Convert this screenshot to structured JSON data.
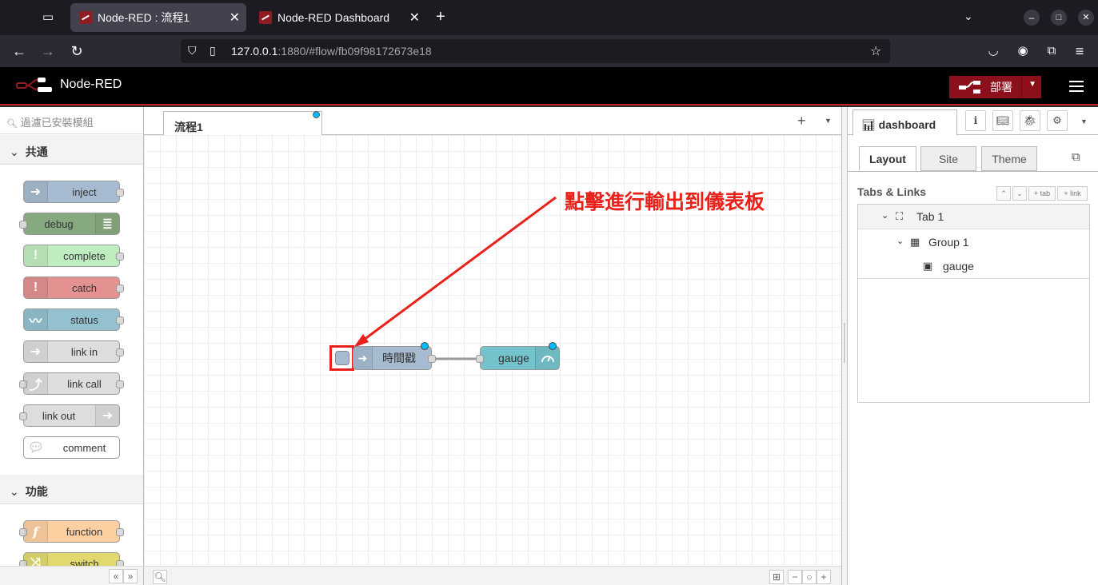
{
  "browser": {
    "tabs": [
      {
        "title": "Node-RED : 流程1",
        "active": true
      },
      {
        "title": "Node-RED Dashboard",
        "active": false
      }
    ],
    "url_host": "127.0.0.1",
    "url_rest": ":1880/#flow/fb09f98172673e18"
  },
  "header": {
    "app_name": "Node-RED",
    "deploy_label": "部署"
  },
  "palette": {
    "search_placeholder": "過濾已安裝模組",
    "categories": [
      {
        "name": "共通",
        "nodes": [
          "inject",
          "debug",
          "complete",
          "catch",
          "status",
          "link in",
          "link call",
          "link out",
          "comment"
        ]
      },
      {
        "name": "功能",
        "nodes": [
          "function",
          "switch"
        ]
      }
    ]
  },
  "workspace": {
    "tab_name": "流程1",
    "nodes": [
      {
        "label": "時間戳",
        "type": "inject"
      },
      {
        "label": "gauge",
        "type": "ui_gauge"
      }
    ]
  },
  "annotation": {
    "text": "點擊進行輸出到儀表板"
  },
  "sidebar": {
    "tab_label": "dashboard",
    "subtabs": [
      "Layout",
      "Site",
      "Theme"
    ],
    "tabs_links_title": "Tabs & Links",
    "buttons": [
      "tab",
      "link"
    ],
    "tree": [
      {
        "level": 0,
        "label": "Tab 1"
      },
      {
        "level": 1,
        "label": "Group 1"
      },
      {
        "level": 2,
        "label": "gauge"
      }
    ]
  },
  "colors": {
    "header_bg": "#000000",
    "deploy_bg": "#8c101c",
    "annotation_red": "#e8221b",
    "inject_node": "#a6bbcf",
    "gauge_node": "#74c2cc"
  }
}
